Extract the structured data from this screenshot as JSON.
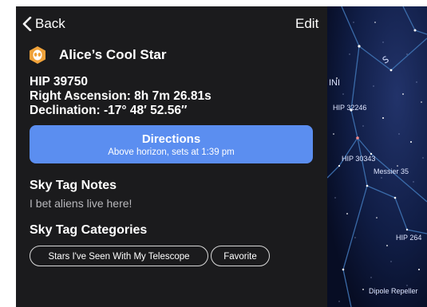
{
  "nav": {
    "back_label": "Back",
    "edit_label": "Edit"
  },
  "star": {
    "name": "Alice’s Cool Star",
    "hip": "HIP 39750",
    "ra": "Right Ascension: 8h 7m 26.81s",
    "dec": "Declination: -17° 48′ 52.56″"
  },
  "directions": {
    "title": "Directions",
    "subtitle": "Above horizon, sets at 1:39 pm"
  },
  "notes": {
    "heading": "Sky Tag Notes",
    "text": "I bet aliens live here!"
  },
  "categories": {
    "heading": "Sky Tag Categories",
    "items": [
      "Stars I've Seen With My Telescope",
      "Favorite"
    ]
  },
  "sky_labels": {
    "ini": "INI",
    "hip1": "HIP 32246",
    "hip2": "HIP 30343",
    "messier": "Messier 35",
    "hip3": "HIP 264",
    "dipole": "Dipole Repeller"
  },
  "colors": {
    "accent": "#5b8ef0",
    "panel": "#1b1b1d",
    "icon": "#f0a23a"
  }
}
